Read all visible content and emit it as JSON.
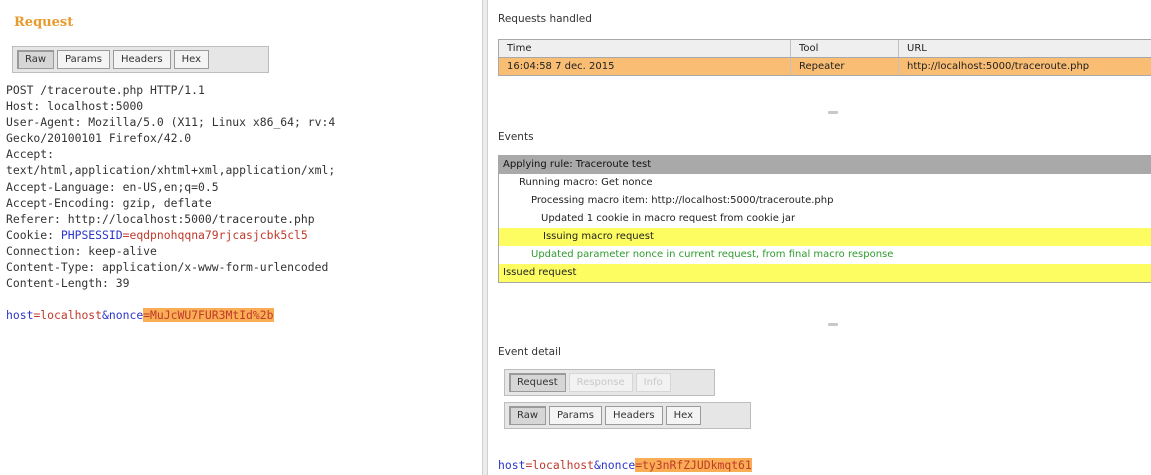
{
  "request_panel": {
    "title": "Request",
    "tabs": [
      "Raw",
      "Params",
      "Headers",
      "Hex"
    ],
    "active_tab": "Raw",
    "lines": [
      "POST /traceroute.php HTTP/1.1",
      "Host: localhost:5000",
      "User-Agent: Mozilla/5.0 (X11; Linux x86_64; rv:4",
      "Gecko/20100101 Firefox/42.0",
      "Accept:",
      "text/html,application/xhtml+xml,application/xml;",
      "Accept-Language: en-US,en;q=0.5",
      "Accept-Encoding: gzip, deflate",
      "Referer: http://localhost:5000/traceroute.php"
    ],
    "cookie_label": "Cookie: ",
    "cookie_name": "PHPSESSID",
    "cookie_eq": "=",
    "cookie_value": "eqdpnohqqna79rjcasjcbk5cl5",
    "lines_after": [
      "Connection: keep-alive",
      "Content-Type: application/x-www-form-urlencoded",
      "Content-Length: 39"
    ],
    "body": {
      "p1_name": "host",
      "p1_eq": "=",
      "p1_value": "localhost",
      "amp": "&",
      "p2_name": "nonce",
      "p2_eq": "=",
      "p2_value": "MuJcWU7FUR3MtId%2b"
    }
  },
  "requests_handled": {
    "label": "Requests handled",
    "columns": [
      "Time",
      "Tool",
      "URL"
    ],
    "rows": [
      {
        "time": "16:04:58 7 dec. 2015",
        "tool": "Repeater",
        "url": "http://localhost:5000/traceroute.php"
      }
    ]
  },
  "events": {
    "label": "Events",
    "items": [
      {
        "text": "Applying rule: Traceroute test",
        "style": "gray",
        "indent": 0
      },
      {
        "text": "Running macro: Get nonce",
        "style": "plain",
        "indent": 1
      },
      {
        "text": "Processing macro item: http://localhost:5000/traceroute.php",
        "style": "plain",
        "indent": 2
      },
      {
        "text": "Updated 1 cookie in macro request from cookie jar",
        "style": "plain",
        "indent": 3
      },
      {
        "text": "Issuing macro request",
        "style": "yellow",
        "indent": 3
      },
      {
        "text": "Updated parameter nonce in current request, from final macro response",
        "style": "green",
        "indent": 2
      },
      {
        "text": "Issued request",
        "style": "yellow",
        "indent": 0
      }
    ]
  },
  "event_detail": {
    "label": "Event detail",
    "outer_tabs": [
      "Request",
      "Response",
      "Info"
    ],
    "outer_active": "Request",
    "inner_tabs": [
      "Raw",
      "Params",
      "Headers",
      "Hex"
    ],
    "inner_active": "Raw",
    "body": {
      "p1_name": "host",
      "p1_eq": "=",
      "p1_value": "localhost",
      "amp": "&",
      "p2_name": "nonce",
      "p2_eq": "=",
      "p2_value": "ty3nRfZJUDkmqt61"
    }
  }
}
